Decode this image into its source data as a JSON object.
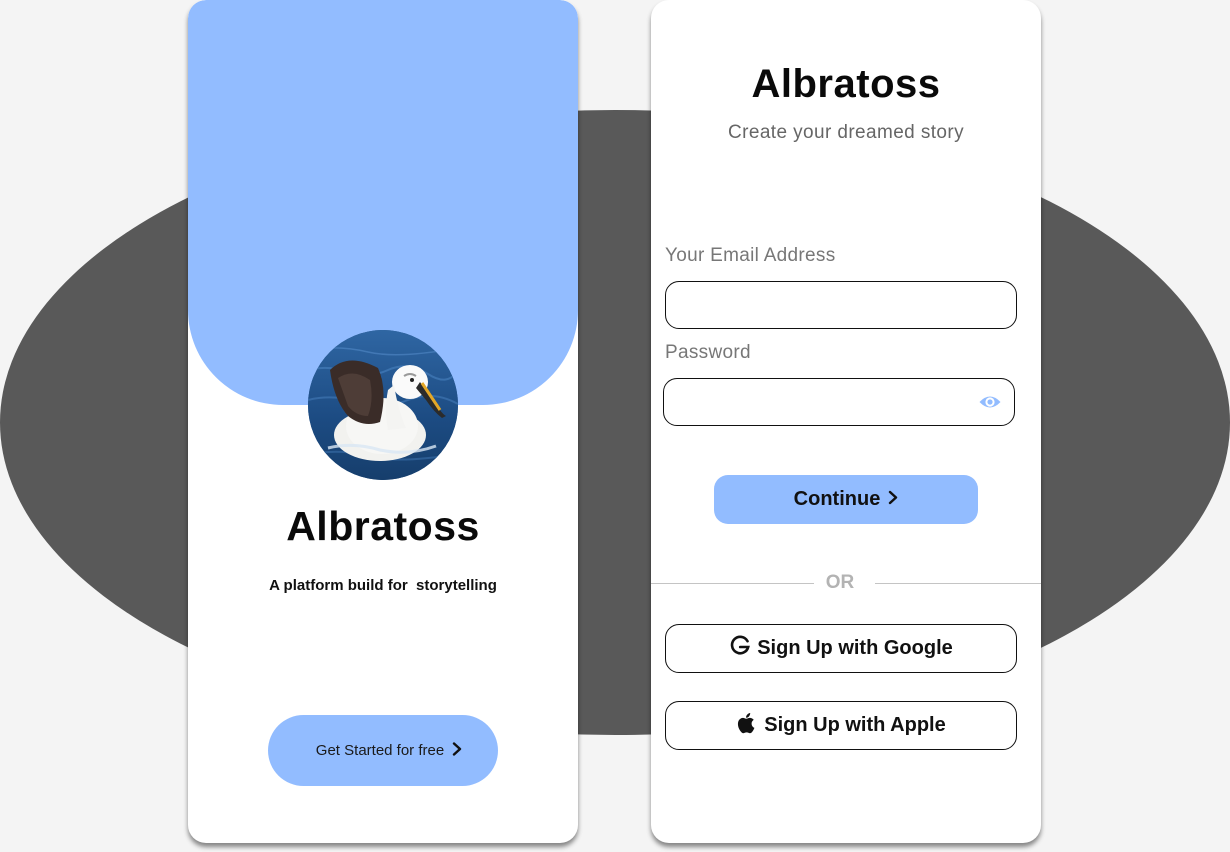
{
  "brand_color": "#92bcff",
  "background_blob_color": "#595959",
  "welcome_screen": {
    "title": "Albratoss",
    "tagline": "A platform build for  storytelling",
    "get_started_label": "Get Started for free",
    "get_started_icon": "chevron-right-icon",
    "avatar": "albatross-bird-photo"
  },
  "signup_screen": {
    "title": "Albratoss",
    "subtitle": "Create your dreamed story",
    "email": {
      "label": "Your Email Address",
      "value": "",
      "placeholder": ""
    },
    "password": {
      "label": "Password",
      "value": "",
      "placeholder": "",
      "toggle_icon": "eye-icon"
    },
    "continue_label": "Continue",
    "continue_icon": "chevron-right-icon",
    "divider_text": "OR",
    "google_label": "Sign Up with Google",
    "google_icon": "google-icon",
    "apple_label": "Sign Up with Apple",
    "apple_icon": "apple-icon"
  }
}
